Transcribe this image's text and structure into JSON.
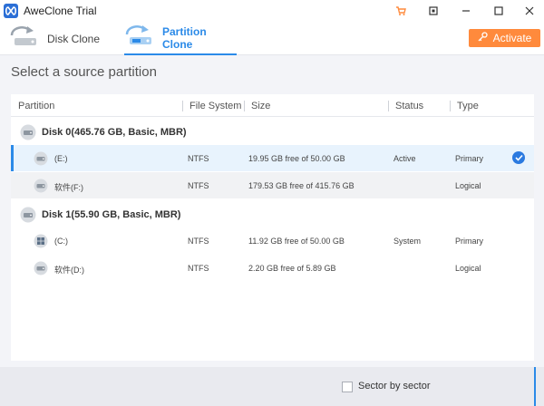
{
  "window": {
    "title": "AweClone Trial",
    "icons": [
      "cart-icon",
      "restore-icon",
      "minimize-icon",
      "maximize-icon",
      "close-icon"
    ]
  },
  "tabs": [
    {
      "label": "Disk Clone",
      "icon": "disk-clone-icon",
      "active": false
    },
    {
      "label": "Partition Clone",
      "icon": "partition-clone-icon",
      "active": true
    }
  ],
  "activate_button": {
    "label": "Activate",
    "icon": "key-icon"
  },
  "heading": "Select a source partition",
  "table": {
    "columns": [
      "Partition",
      "File System",
      "Size",
      "Status",
      "Type"
    ],
    "disks": [
      {
        "label": "Disk 0(465.76 GB, Basic, MBR)",
        "partitions": [
          {
            "name": "(E:)",
            "fs": "NTFS",
            "size": "19.95 GB free of 50.00 GB",
            "status": "Active",
            "type": "Primary",
            "selected": true
          },
          {
            "name": "软件(F:)",
            "fs": "NTFS",
            "size": "179.53 GB free of 415.76 GB",
            "status": "",
            "type": "Logical",
            "selected": false
          }
        ]
      },
      {
        "label": "Disk 1(55.90 GB, Basic, MBR)",
        "partitions": [
          {
            "name": "(C:)",
            "fs": "NTFS",
            "size": "11.92 GB free of 50.00 GB",
            "status": "System",
            "type": "Primary",
            "selected": false
          },
          {
            "name": "软件(D:)",
            "fs": "NTFS",
            "size": "2.20 GB free of 5.89 GB",
            "status": "",
            "type": "Logical",
            "selected": false
          }
        ]
      }
    ]
  },
  "footer": {
    "sector_checkbox_label": "Sector by sector",
    "sector_checked": false
  },
  "colors": {
    "accent": "#2b8ae8",
    "activate": "#ff8a3c",
    "selected_row": "#e8f3fd"
  }
}
